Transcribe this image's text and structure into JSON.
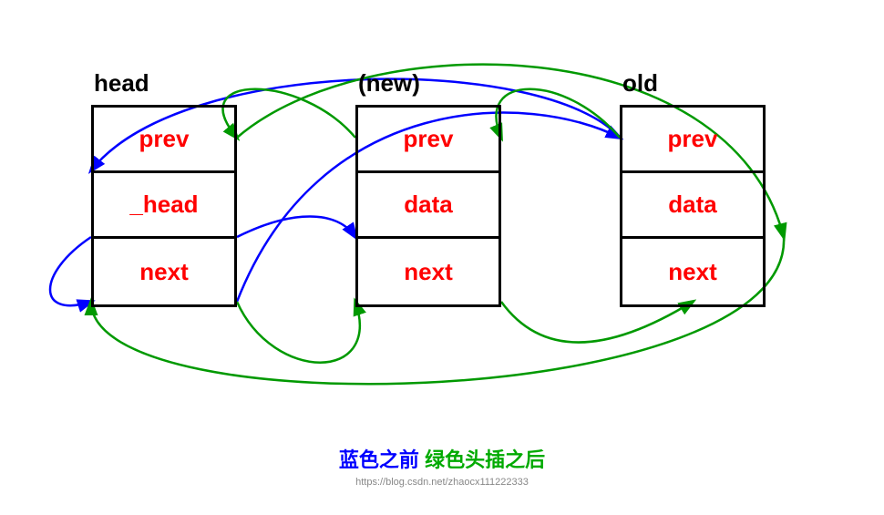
{
  "nodes": {
    "head": {
      "label": "head",
      "cells": [
        "prev",
        "_head",
        "next"
      ]
    },
    "new": {
      "label": "(new)",
      "cells": [
        "prev",
        "data",
        "next"
      ]
    },
    "old": {
      "label": "old",
      "cells": [
        "prev",
        "data",
        "next"
      ]
    }
  },
  "caption": {
    "blue_text": "蓝色之前",
    "green_text": "绿色头插之后"
  },
  "watermark": "https://blog.csdn.net/zhaocx111222333"
}
